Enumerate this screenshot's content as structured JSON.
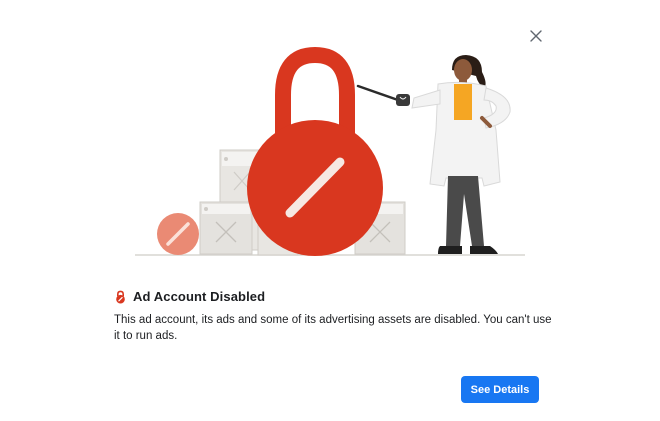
{
  "dialog": {
    "title": "Ad Account Disabled",
    "body": "This ad account, its ads and some of its advertising assets are disabled. You can't use it to run ads.",
    "primary_button": "See Details",
    "close_icon": "close-icon",
    "status_icon": "lock-disabled-icon"
  },
  "illustration": {
    "subject": "Person in lab coat pointing at a large red disabled padlock with disabled ad cards",
    "colors": {
      "lock_red": "#d9371f",
      "lock_light": "#ea8a74",
      "card_gray": "#e4e2de",
      "coat": "#f3f3f3",
      "shirt": "#f5a623",
      "pants": "#4a4a4a"
    }
  },
  "colors": {
    "primary": "#1877f2",
    "text": "#1c1e21"
  }
}
